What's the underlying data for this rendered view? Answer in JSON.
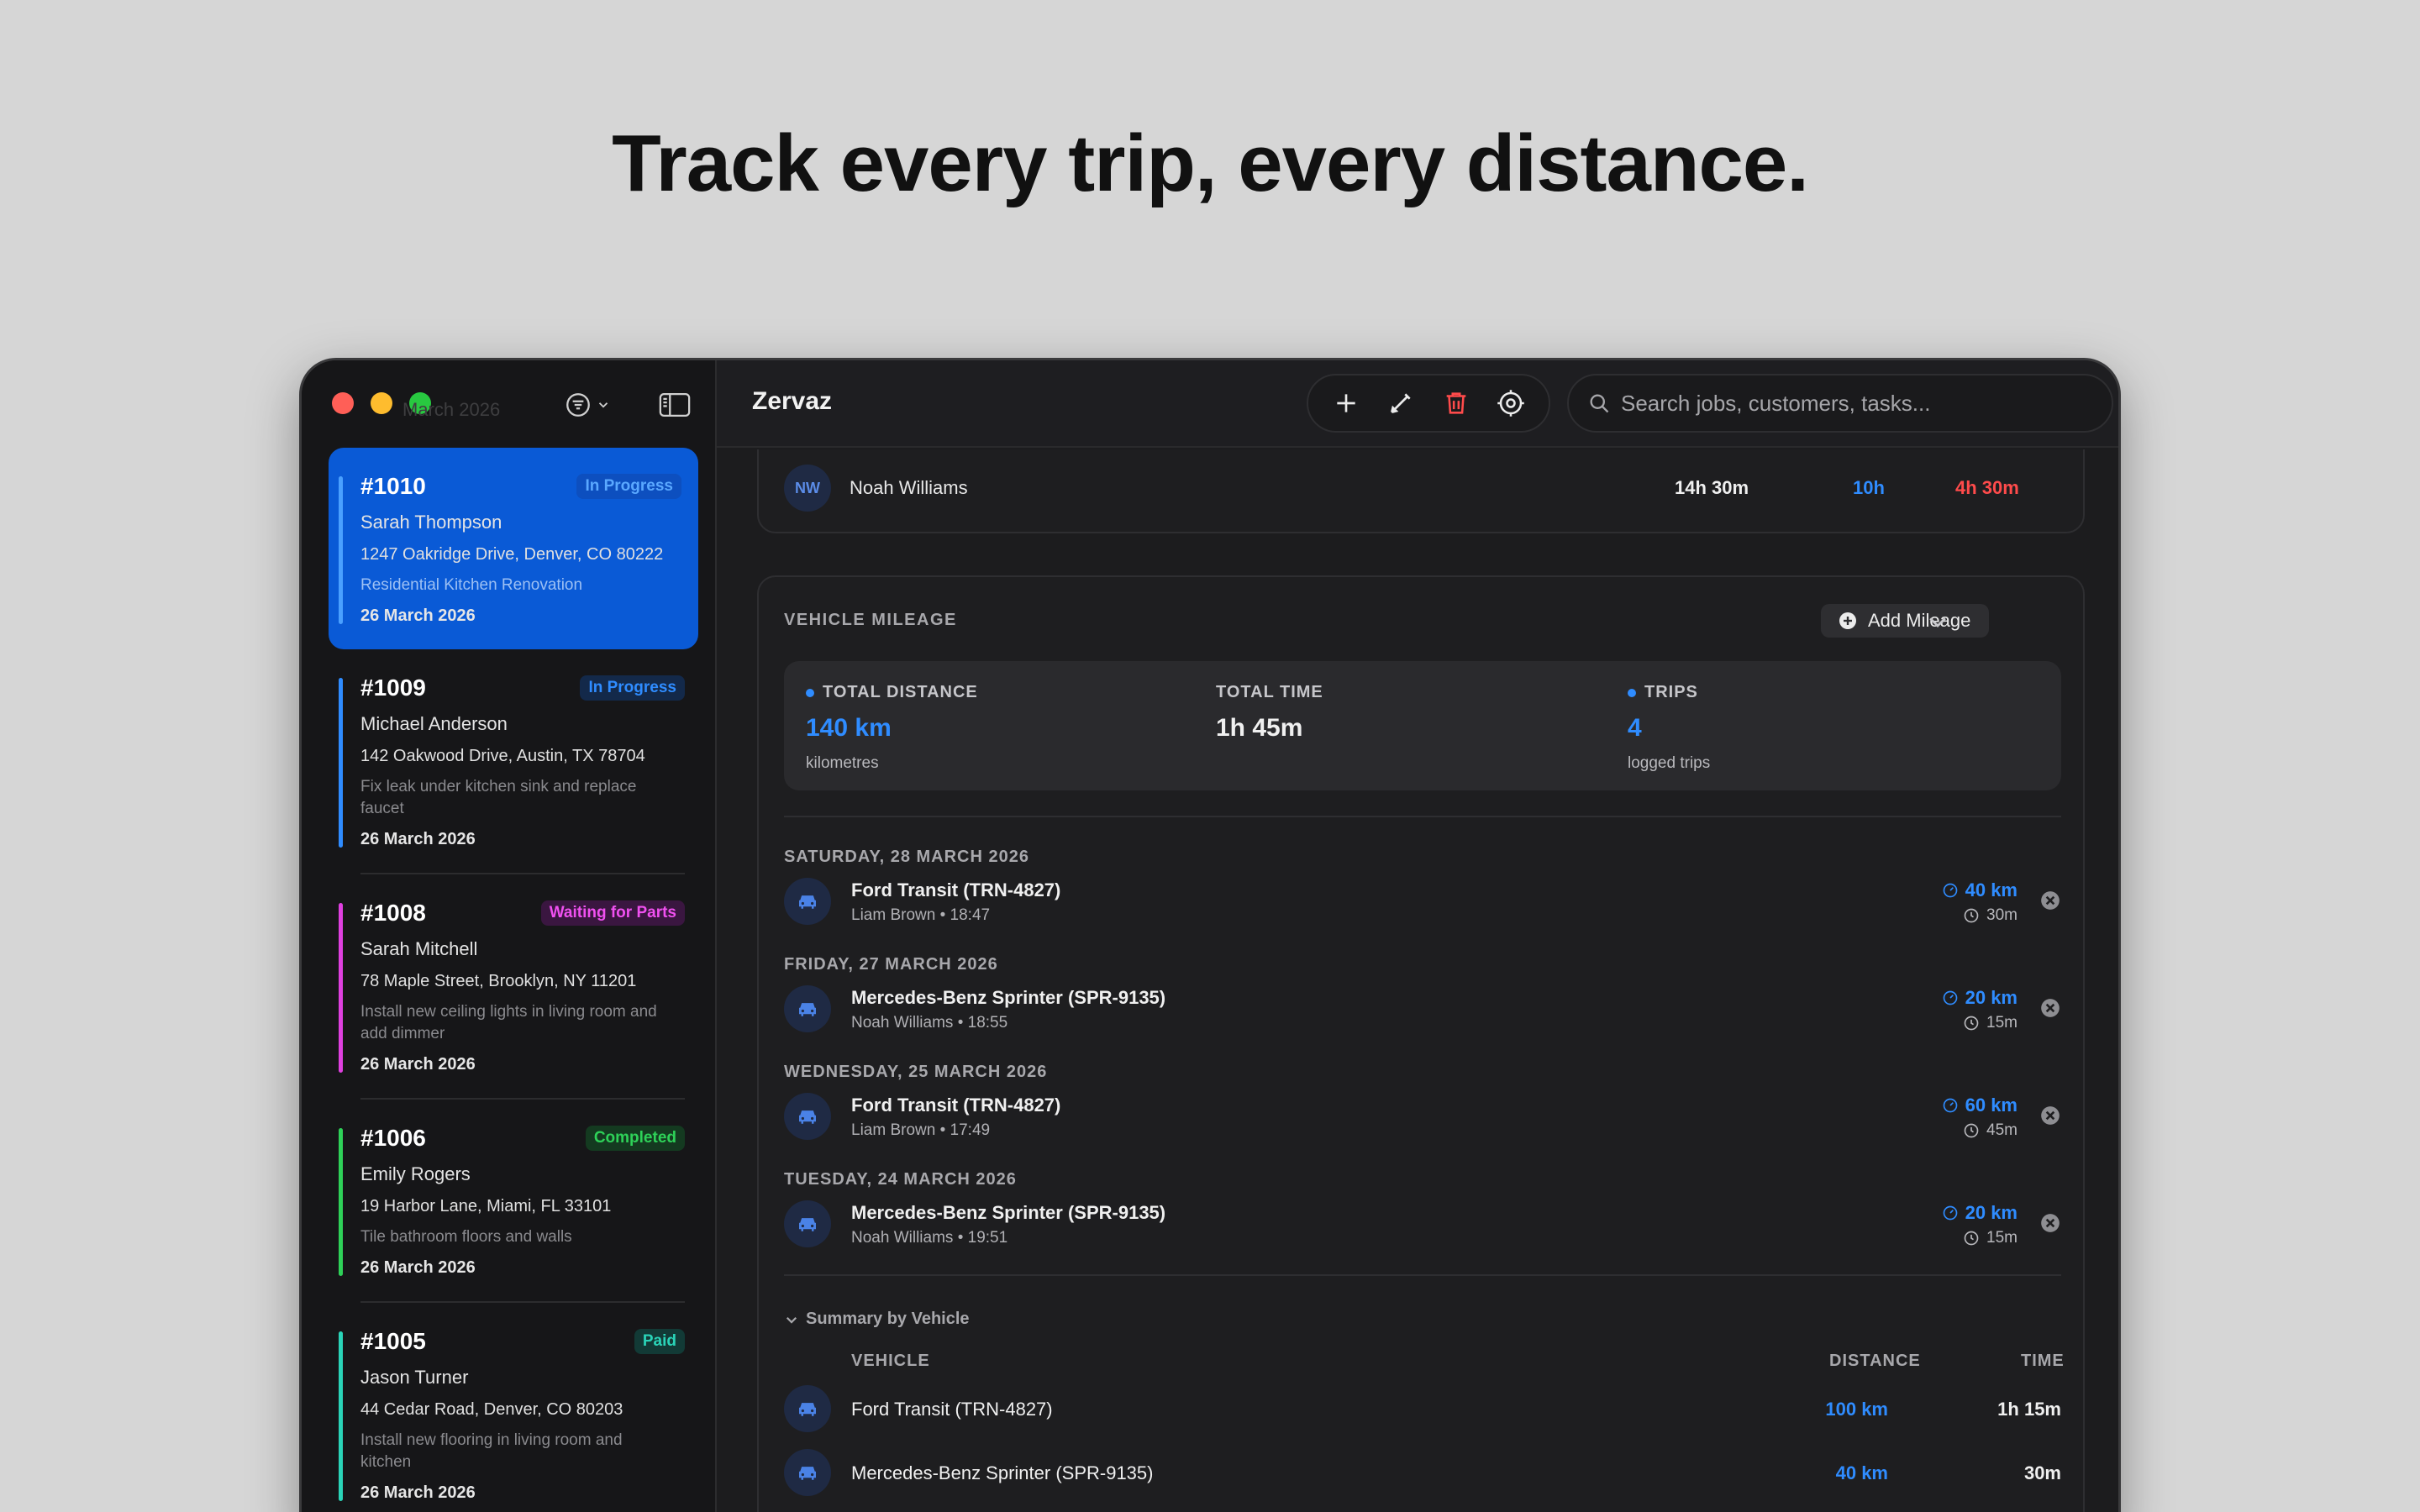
{
  "headline": "Track every trip, every distance.",
  "sidebar": {
    "ghost_text": "March 2026",
    "jobs": [
      {
        "number": "#1010",
        "status": "In Progress",
        "customer": "Sarah Thompson",
        "address": "1247 Oakridge Drive, Denver, CO 80222",
        "description": "Residential Kitchen Renovation",
        "date": "26 March 2026"
      },
      {
        "number": "#1009",
        "status": "In Progress",
        "customer": "Michael Anderson",
        "address": "142 Oakwood Drive, Austin, TX 78704",
        "description": "Fix leak under kitchen sink and replace faucet",
        "date": "26 March 2026"
      },
      {
        "number": "#1008",
        "status": "Waiting for Parts",
        "customer": "Sarah Mitchell",
        "address": "78 Maple Street, Brooklyn, NY 11201",
        "description": "Install new ceiling lights in living room and add dimmer",
        "date": "26 March 2026"
      },
      {
        "number": "#1006",
        "status": "Completed",
        "customer": "Emily Rogers",
        "address": "19 Harbor Lane, Miami, FL 33101",
        "description": "Tile bathroom floors and walls",
        "date": "26 March 2026"
      },
      {
        "number": "#1005",
        "status": "Paid",
        "customer": "Jason Turner",
        "address": "44 Cedar Road, Denver, CO 80203",
        "description": "Install new flooring in living room and kitchen",
        "date": "26 March 2026"
      }
    ],
    "status_colors": {
      "In Progress": "#2f8cff",
      "Waiting for Parts": "#e040e0",
      "Completed": "#2ed158",
      "Paid": "#2ad4b8"
    }
  },
  "toolbar": {
    "title": "Zervaz",
    "icons": [
      "plus-icon",
      "pencil-icon",
      "trash-icon",
      "gear-icon"
    ],
    "search_placeholder": "Search jobs, customers, tasks..."
  },
  "labour_row": {
    "initials": "NW",
    "name": "Noah Williams",
    "total": "14h 30m",
    "billed": "10h",
    "remaining": "4h 30m"
  },
  "mileage": {
    "section_title": "VEHICLE MILEAGE",
    "add_label": "Add Mileage",
    "stats": {
      "distance_label": "TOTAL DISTANCE",
      "distance_value": "140 km",
      "distance_sub": "kilometres",
      "time_label": "TOTAL TIME",
      "time_value": "1h 45m",
      "trips_label": "TRIPS",
      "trips_value": "4",
      "trips_sub": "logged trips"
    },
    "days": [
      {
        "label": "SATURDAY, 28 MARCH 2026",
        "vehicle": "Ford Transit (TRN-4827)",
        "sub": "Liam Brown • 18:47",
        "distance": "40 km",
        "time": "30m"
      },
      {
        "label": "FRIDAY, 27 MARCH 2026",
        "vehicle": "Mercedes-Benz Sprinter (SPR-9135)",
        "sub": "Noah Williams • 18:55",
        "distance": "20 km",
        "time": "15m"
      },
      {
        "label": "WEDNESDAY, 25 MARCH 2026",
        "vehicle": "Ford Transit (TRN-4827)",
        "sub": "Liam Brown • 17:49",
        "distance": "60 km",
        "time": "45m"
      },
      {
        "label": "TUESDAY, 24 MARCH 2026",
        "vehicle": "Mercedes-Benz Sprinter (SPR-9135)",
        "sub": "Noah Williams • 19:51",
        "distance": "20 km",
        "time": "15m"
      }
    ],
    "summary": {
      "toggle_label": "Summary by Vehicle",
      "col_vehicle": "VEHICLE",
      "col_distance": "DISTANCE",
      "col_time": "TIME",
      "rows": [
        {
          "vehicle": "Ford Transit (TRN-4827)",
          "distance": "100 km",
          "time": "1h 15m"
        },
        {
          "vehicle": "Mercedes-Benz Sprinter (SPR-9135)",
          "distance": "40 km",
          "time": "30m"
        }
      ]
    }
  }
}
